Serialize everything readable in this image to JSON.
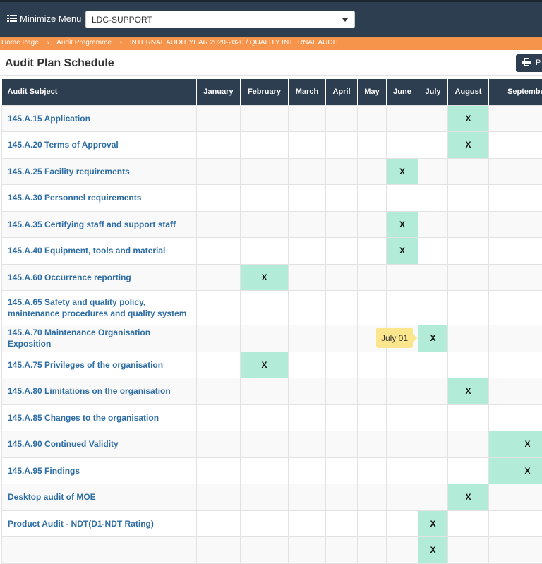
{
  "topbar": {
    "minimize_label": "Minimize Menu",
    "select_value": "LDC-SUPPORT"
  },
  "breadcrumb": {
    "items": [
      "Home Page",
      "Audit Programme",
      "INTERNAL AUDIT YEAR 2020-2020 / QUALITY INTERNAL AUDIT"
    ]
  },
  "page": {
    "title": "Audit Plan Schedule",
    "print_label": "P"
  },
  "table": {
    "subject_header": "Audit Subject",
    "months": [
      "January",
      "February",
      "March",
      "April",
      "May",
      "June",
      "July",
      "August",
      "September"
    ],
    "rows": [
      {
        "subject": "145.A.15 Application",
        "mark": "August"
      },
      {
        "subject": "145.A.20 Terms of Approval",
        "mark": "August"
      },
      {
        "subject": "145.A.25 Facility requirements",
        "mark": "June"
      },
      {
        "subject": "145.A.30 Personnel requirements",
        "mark": ""
      },
      {
        "subject": "145.A.35 Certifying staff and support staff",
        "mark": "June"
      },
      {
        "subject": "145.A.40 Equipment, tools and material",
        "mark": "June"
      },
      {
        "subject": "145.A.60 Occurrence reporting",
        "mark": "February"
      },
      {
        "subject": "145.A.65 Safety and quality policy, maintenance procedures and quality system",
        "mark": ""
      },
      {
        "subject": "145.A.70 Maintenance Organisation Exposition",
        "mark": "July"
      },
      {
        "subject": "145.A.75 Privileges of the organisation",
        "mark": "February"
      },
      {
        "subject": "145.A.80 Limitations on the organisation",
        "mark": "August"
      },
      {
        "subject": "145.A.85 Changes to the organisation",
        "mark": ""
      },
      {
        "subject": "145.A.90 Continued Validity",
        "mark": "September"
      },
      {
        "subject": "145.A.95 Findings",
        "mark": "September"
      },
      {
        "subject": "Desktop audit of MOE",
        "mark": "August"
      },
      {
        "subject": "Product Audit - NDT(D1-NDT Rating)",
        "mark": "July"
      },
      {
        "subject": "",
        "mark": "July"
      }
    ],
    "mark_symbol": "X"
  },
  "tooltip": {
    "text": "July 01"
  },
  "colors": {
    "header_bg": "#2c3e50",
    "breadcrumb_bg": "#f7944b",
    "mark_bg": "#b2ebd8",
    "link": "#2e6da4",
    "tooltip_bg": "#fbe68d"
  }
}
